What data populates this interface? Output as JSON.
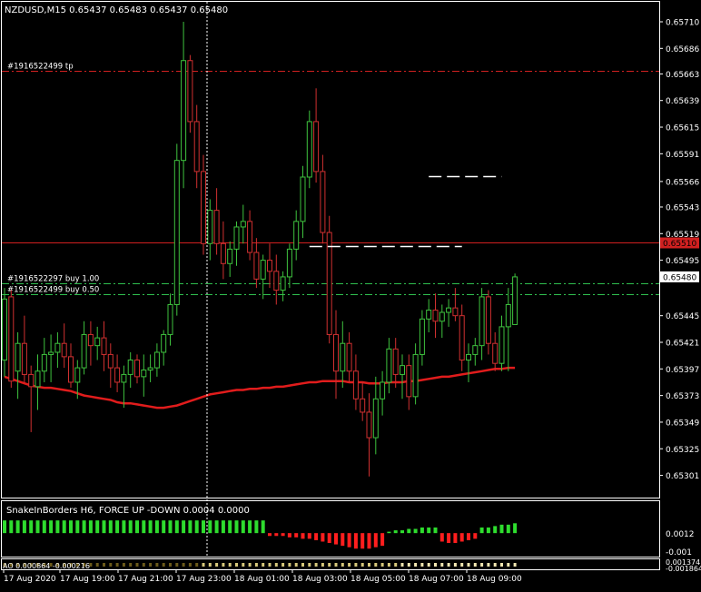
{
  "main_chart": {
    "header": "NZDUSD,M15  0.65437 0.65483 0.65437 0.65480",
    "ylim": [
      0.65281,
      0.65728
    ],
    "price_ticks": [
      "0.65710",
      "0.65686",
      "0.65663",
      "0.65639",
      "0.65615",
      "0.65591",
      "0.65566",
      "0.65543",
      "0.65519",
      "0.65495",
      "0.65480",
      "0.65445",
      "0.65421",
      "0.65397",
      "0.65373",
      "0.65349",
      "0.65325",
      "0.65301"
    ],
    "levels": [
      {
        "label": "#1916522499 tp",
        "price": 0.65666,
        "color": "#d02020",
        "style": "dashdot"
      },
      {
        "label": "",
        "price": 0.65511,
        "color": "#d02020",
        "style": "solid",
        "price_tag": "0.65510"
      },
      {
        "label": "#1916522297 buy 1.00",
        "price": 0.65474,
        "color": "#2fbf4f",
        "style": "dashdot"
      },
      {
        "label": "#1916522499 buy 0.50",
        "price": 0.65464,
        "color": "#2fbf4f",
        "style": "dashdot"
      }
    ],
    "current_price_tag": "0.65480",
    "colors": {
      "bull": "#3ec23e",
      "bear": "#d03030",
      "ma": "#e11c1c",
      "grid_line": "#ffffff",
      "axis_tag": "#ffffff"
    }
  },
  "chart_data": {
    "type": "candlestick",
    "symbol": "NZDUSD",
    "timeframe": "M15",
    "ylim": [
      0.65281,
      0.65728
    ],
    "candles": [
      {
        "o": 0.65405,
        "h": 0.6547,
        "l": 0.6539,
        "c": 0.6546
      },
      {
        "o": 0.65462,
        "h": 0.65468,
        "l": 0.6538,
        "c": 0.65386
      },
      {
        "o": 0.65395,
        "h": 0.6543,
        "l": 0.6537,
        "c": 0.6542
      },
      {
        "o": 0.6542,
        "h": 0.65445,
        "l": 0.65385,
        "c": 0.65392
      },
      {
        "o": 0.65392,
        "h": 0.654,
        "l": 0.6534,
        "c": 0.65381
      },
      {
        "o": 0.65381,
        "h": 0.6541,
        "l": 0.6536,
        "c": 0.65395
      },
      {
        "o": 0.65395,
        "h": 0.65425,
        "l": 0.65385,
        "c": 0.6541
      },
      {
        "o": 0.6541,
        "h": 0.65428,
        "l": 0.65385,
        "c": 0.65412
      },
      {
        "o": 0.65412,
        "h": 0.6543,
        "l": 0.65398,
        "c": 0.6542
      },
      {
        "o": 0.6542,
        "h": 0.65438,
        "l": 0.65398,
        "c": 0.65408
      },
      {
        "o": 0.65408,
        "h": 0.6542,
        "l": 0.6538,
        "c": 0.65385
      },
      {
        "o": 0.65385,
        "h": 0.65405,
        "l": 0.6537,
        "c": 0.65398
      },
      {
        "o": 0.65398,
        "h": 0.6544,
        "l": 0.65392,
        "c": 0.65428
      },
      {
        "o": 0.65428,
        "h": 0.6544,
        "l": 0.654,
        "c": 0.65418
      },
      {
        "o": 0.65418,
        "h": 0.65435,
        "l": 0.65405,
        "c": 0.65425
      },
      {
        "o": 0.65425,
        "h": 0.6544,
        "l": 0.65395,
        "c": 0.6541
      },
      {
        "o": 0.6541,
        "h": 0.6542,
        "l": 0.6538,
        "c": 0.65398
      },
      {
        "o": 0.65398,
        "h": 0.6541,
        "l": 0.65376,
        "c": 0.65385
      },
      {
        "o": 0.65385,
        "h": 0.654,
        "l": 0.65362,
        "c": 0.65392
      },
      {
        "o": 0.65392,
        "h": 0.65412,
        "l": 0.6538,
        "c": 0.65405
      },
      {
        "o": 0.65405,
        "h": 0.6541,
        "l": 0.65384,
        "c": 0.6539
      },
      {
        "o": 0.6539,
        "h": 0.6541,
        "l": 0.65372,
        "c": 0.65396
      },
      {
        "o": 0.65396,
        "h": 0.6541,
        "l": 0.65385,
        "c": 0.65398
      },
      {
        "o": 0.65398,
        "h": 0.6542,
        "l": 0.6539,
        "c": 0.65412
      },
      {
        "o": 0.65412,
        "h": 0.65432,
        "l": 0.654,
        "c": 0.65428
      },
      {
        "o": 0.65428,
        "h": 0.65465,
        "l": 0.65418,
        "c": 0.65455
      },
      {
        "o": 0.65455,
        "h": 0.656,
        "l": 0.65445,
        "c": 0.65585
      },
      {
        "o": 0.65585,
        "h": 0.6571,
        "l": 0.6556,
        "c": 0.65675
      },
      {
        "o": 0.65675,
        "h": 0.6568,
        "l": 0.6561,
        "c": 0.6562
      },
      {
        "o": 0.6562,
        "h": 0.65635,
        "l": 0.6556,
        "c": 0.65575
      },
      {
        "o": 0.65575,
        "h": 0.6559,
        "l": 0.655,
        "c": 0.6551
      },
      {
        "o": 0.6551,
        "h": 0.6555,
        "l": 0.65495,
        "c": 0.6554
      },
      {
        "o": 0.6554,
        "h": 0.6556,
        "l": 0.655,
        "c": 0.6551
      },
      {
        "o": 0.6551,
        "h": 0.6553,
        "l": 0.65478,
        "c": 0.65492
      },
      {
        "o": 0.65492,
        "h": 0.65512,
        "l": 0.6548,
        "c": 0.65505
      },
      {
        "o": 0.65505,
        "h": 0.6553,
        "l": 0.6549,
        "c": 0.65525
      },
      {
        "o": 0.65525,
        "h": 0.65545,
        "l": 0.6551,
        "c": 0.6553
      },
      {
        "o": 0.6553,
        "h": 0.6554,
        "l": 0.65495,
        "c": 0.65502
      },
      {
        "o": 0.65502,
        "h": 0.65515,
        "l": 0.6547,
        "c": 0.65478
      },
      {
        "o": 0.65478,
        "h": 0.655,
        "l": 0.6546,
        "c": 0.65495
      },
      {
        "o": 0.65495,
        "h": 0.6551,
        "l": 0.6547,
        "c": 0.65485
      },
      {
        "o": 0.65485,
        "h": 0.655,
        "l": 0.65455,
        "c": 0.65468
      },
      {
        "o": 0.65468,
        "h": 0.65485,
        "l": 0.65458,
        "c": 0.6548
      },
      {
        "o": 0.6548,
        "h": 0.6551,
        "l": 0.6547,
        "c": 0.65505
      },
      {
        "o": 0.65505,
        "h": 0.6554,
        "l": 0.65495,
        "c": 0.6553
      },
      {
        "o": 0.6553,
        "h": 0.6558,
        "l": 0.65515,
        "c": 0.6557
      },
      {
        "o": 0.6557,
        "h": 0.6563,
        "l": 0.6556,
        "c": 0.6562
      },
      {
        "o": 0.6562,
        "h": 0.6565,
        "l": 0.65565,
        "c": 0.65575
      },
      {
        "o": 0.65575,
        "h": 0.6559,
        "l": 0.6551,
        "c": 0.6552
      },
      {
        "o": 0.6552,
        "h": 0.65535,
        "l": 0.6542,
        "c": 0.65428
      },
      {
        "o": 0.65428,
        "h": 0.6545,
        "l": 0.6537,
        "c": 0.65395
      },
      {
        "o": 0.65395,
        "h": 0.6544,
        "l": 0.6538,
        "c": 0.6542
      },
      {
        "o": 0.6542,
        "h": 0.6543,
        "l": 0.65385,
        "c": 0.65395
      },
      {
        "o": 0.65395,
        "h": 0.6541,
        "l": 0.6536,
        "c": 0.6537
      },
      {
        "o": 0.6537,
        "h": 0.65385,
        "l": 0.6535,
        "c": 0.65358
      },
      {
        "o": 0.65358,
        "h": 0.65375,
        "l": 0.653,
        "c": 0.65335
      },
      {
        "o": 0.65335,
        "h": 0.6539,
        "l": 0.6532,
        "c": 0.6537
      },
      {
        "o": 0.6537,
        "h": 0.65395,
        "l": 0.65355,
        "c": 0.65385
      },
      {
        "o": 0.65385,
        "h": 0.65425,
        "l": 0.65375,
        "c": 0.65415
      },
      {
        "o": 0.65415,
        "h": 0.65425,
        "l": 0.6538,
        "c": 0.65392
      },
      {
        "o": 0.65392,
        "h": 0.6541,
        "l": 0.6537,
        "c": 0.654
      },
      {
        "o": 0.654,
        "h": 0.6541,
        "l": 0.6536,
        "c": 0.65372
      },
      {
        "o": 0.65372,
        "h": 0.6542,
        "l": 0.65365,
        "c": 0.6541
      },
      {
        "o": 0.6541,
        "h": 0.6545,
        "l": 0.654,
        "c": 0.65442
      },
      {
        "o": 0.65442,
        "h": 0.6546,
        "l": 0.6543,
        "c": 0.6545
      },
      {
        "o": 0.6545,
        "h": 0.65465,
        "l": 0.65425,
        "c": 0.6544
      },
      {
        "o": 0.6544,
        "h": 0.65455,
        "l": 0.65425,
        "c": 0.65448
      },
      {
        "o": 0.65448,
        "h": 0.6546,
        "l": 0.65435,
        "c": 0.65452
      },
      {
        "o": 0.65452,
        "h": 0.6547,
        "l": 0.6544,
        "c": 0.65445
      },
      {
        "o": 0.65445,
        "h": 0.65455,
        "l": 0.65395,
        "c": 0.65405
      },
      {
        "o": 0.65405,
        "h": 0.6542,
        "l": 0.65385,
        "c": 0.6541
      },
      {
        "o": 0.6541,
        "h": 0.65425,
        "l": 0.654,
        "c": 0.65418
      },
      {
        "o": 0.65418,
        "h": 0.6547,
        "l": 0.65405,
        "c": 0.65462
      },
      {
        "o": 0.65462,
        "h": 0.65468,
        "l": 0.6541,
        "c": 0.6542
      },
      {
        "o": 0.6542,
        "h": 0.6543,
        "l": 0.65395,
        "c": 0.65402
      },
      {
        "o": 0.65402,
        "h": 0.65445,
        "l": 0.65395,
        "c": 0.65435
      },
      {
        "o": 0.65435,
        "h": 0.6547,
        "l": 0.65395,
        "c": 0.65455
      },
      {
        "o": 0.65437,
        "h": 0.65483,
        "l": 0.65437,
        "c": 0.6548
      }
    ],
    "moving_average": [
      0.6539,
      0.65388,
      0.65386,
      0.65384,
      0.65382,
      0.65381,
      0.6538,
      0.6538,
      0.65379,
      0.65378,
      0.65377,
      0.65375,
      0.65373,
      0.65372,
      0.65371,
      0.6537,
      0.65369,
      0.65367,
      0.65366,
      0.65366,
      0.65365,
      0.65364,
      0.65363,
      0.65362,
      0.65362,
      0.65363,
      0.65364,
      0.65366,
      0.65368,
      0.6537,
      0.65372,
      0.65374,
      0.65375,
      0.65376,
      0.65377,
      0.65378,
      0.65378,
      0.65379,
      0.65379,
      0.6538,
      0.6538,
      0.65381,
      0.65381,
      0.65382,
      0.65383,
      0.65384,
      0.65385,
      0.65385,
      0.65386,
      0.65386,
      0.65386,
      0.65386,
      0.65385,
      0.65385,
      0.65385,
      0.65384,
      0.65384,
      0.65384,
      0.65385,
      0.65385,
      0.65385,
      0.65386,
      0.65386,
      0.65387,
      0.65388,
      0.65389,
      0.6539,
      0.6539,
      0.65391,
      0.65392,
      0.65393,
      0.65394,
      0.65395,
      0.65396,
      0.65397,
      0.65397,
      0.65398,
      0.65398
    ],
    "dashed_bars": [
      {
        "price": 0.65571,
        "from_candle": 64,
        "to_candle": 75,
        "color": "#ffffff"
      },
      {
        "price": 0.65508,
        "from_candle": 46,
        "to_candle": 69,
        "color": "#ffffff"
      }
    ]
  },
  "indicator1": {
    "label": "SnakeInBorders H6, FORCE UP -DOWN  0.0004 0.0000",
    "ylim": [
      -0.0016,
      0.0022
    ],
    "ticks": [
      "0.0012",
      "-0.001"
    ],
    "values": [
      0.0009,
      0.0009,
      0.0009,
      0.0009,
      0.0009,
      0.0009,
      0.0009,
      0.0009,
      0.0009,
      0.0009,
      0.0009,
      0.0009,
      0.0009,
      0.0009,
      0.0009,
      0.0009,
      0.0009,
      0.0009,
      0.0009,
      0.0009,
      0.0009,
      0.0009,
      0.0009,
      0.0009,
      0.0009,
      0.0009,
      0.0009,
      0.0009,
      0.0009,
      0.0009,
      0.0009,
      0.0009,
      0.0009,
      0.0009,
      0.0009,
      0.0009,
      0.0009,
      0.0009,
      0.0009,
      0.0009,
      -0.0002,
      -0.0002,
      -0.0002,
      -0.0003,
      -0.0003,
      -0.0004,
      -0.0004,
      -0.0005,
      -0.0006,
      -0.0007,
      -0.0008,
      -0.0009,
      -0.001,
      -0.0011,
      -0.0011,
      -0.0011,
      -0.001,
      -0.0009,
      0.0001,
      0.0002,
      0.0002,
      0.0003,
      0.0003,
      0.0004,
      0.0004,
      0.0004,
      -0.0006,
      -0.0007,
      -0.0007,
      -0.0006,
      -0.0005,
      -0.0004,
      0.0004,
      0.0004,
      0.0005,
      0.0006,
      0.0006,
      0.0007
    ],
    "bull_color": "#2edc2e",
    "bear_color": "#ff1e1e"
  },
  "indicator2": {
    "label": "AO  0.000864 -0.000216",
    "ticks": [
      "0.001374",
      "-0.001864"
    ]
  },
  "time_axis": [
    "17 Aug 2020",
    "17 Aug 19:00",
    "17 Aug 21:00",
    "17 Aug 23:00",
    "18 Aug 01:00",
    "18 Aug 03:00",
    "18 Aug 05:00",
    "18 Aug 07:00",
    "18 Aug 09:00"
  ]
}
